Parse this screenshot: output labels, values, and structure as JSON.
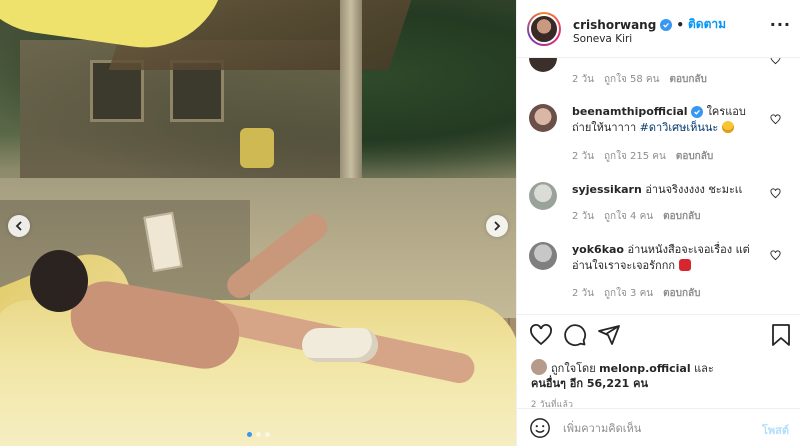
{
  "post": {
    "username": "crishorwang",
    "follow_label": "ติดตาม",
    "location": "Soneva Kiri",
    "more_label": "···",
    "slide_count": 3,
    "active_slide": 1
  },
  "comments": [
    {
      "username": "",
      "text": "",
      "age": "2 วัน",
      "likes": "ถูกใจ 58 คน",
      "reply": "ตอบกลับ"
    },
    {
      "username": "beenamthipofficial",
      "verified": true,
      "text": "ใครแอบถ่ายให้นาาาา ",
      "hashtag": "#ดาวิเศษเห็นนะ",
      "emoji": "grinning-sweat-emoji",
      "age": "2 วัน",
      "likes": "ถูกใจ 215 คน",
      "reply": "ตอบกลับ"
    },
    {
      "username": "syjessikarn",
      "text": "อ่านจริงงงงง ชะมะเเ",
      "age": "2 วัน",
      "likes": "ถูกใจ 4 คน",
      "reply": "ตอบกลับ"
    },
    {
      "username": "yok6kao",
      "text": "อ่านหนังสือจะเจอเรื่อง แต่อ่านใจเราจะเจอรักกก ",
      "emoji": "heart-emoji",
      "age": "2 วัน",
      "likes": "ถูกใจ 3 คน",
      "reply": "ตอบกลับ"
    }
  ],
  "likes": {
    "prefix": "ถูกใจโดย ",
    "user": "melonp.official",
    "middle": " และ",
    "others": "คนอื่นๆ อีก 56,221 คน"
  },
  "time_ago": "2 วันที่แล้ว",
  "composer": {
    "placeholder": "เพิ่มความคิดเห็น",
    "post_label": "โพสต์"
  },
  "colors": {
    "accent": "#0095f6",
    "verified": "#3897f0",
    "muted": "#8e8e8e"
  }
}
